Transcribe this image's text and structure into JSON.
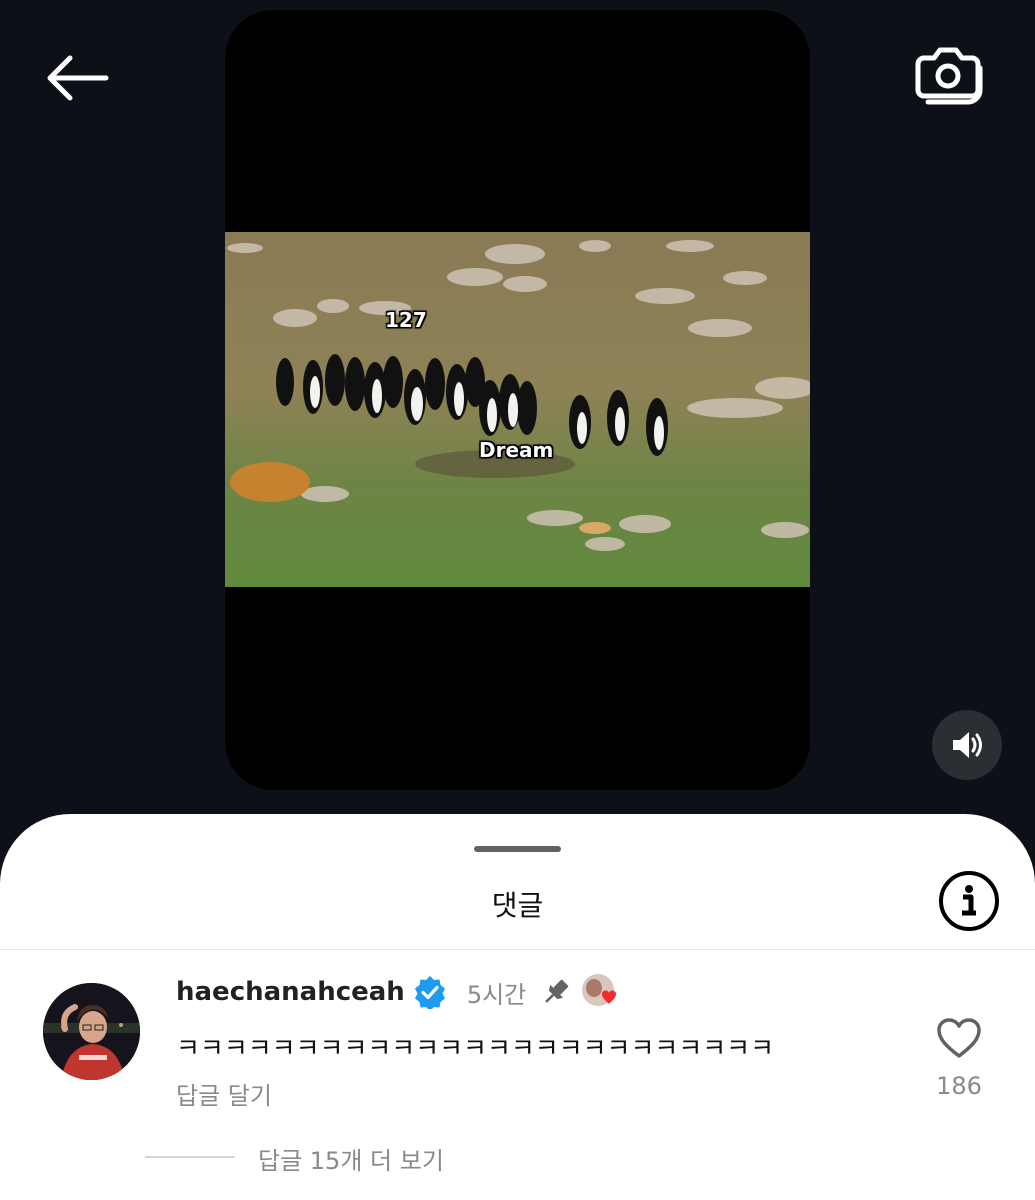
{
  "header": {
    "back_icon": "arrow-left-icon",
    "camera_icon": "camera-icon"
  },
  "video": {
    "overlay_top_label": "127",
    "overlay_bottom_label": "Dream",
    "volume_icon": "speaker-icon"
  },
  "comments_sheet": {
    "title": "댓글",
    "info_icon": "info-icon",
    "comment": {
      "username": "haechanahceah",
      "verified_icon": "verified-badge-icon",
      "time": "5시간",
      "pin_icon": "pin-icon",
      "text": "ㅋㅋㅋㅋㅋㅋㅋㅋㅋㅋㅋㅋㅋㅋㅋㅋㅋㅋㅋㅋㅋㅋㅋㅋㅋ",
      "reply_label": "답글 달기",
      "like_icon": "heart-outline-icon",
      "like_count": "186",
      "view_more_replies": "답글 15개 더 보기"
    }
  },
  "colors": {
    "background": "#0d1117",
    "verified_blue": "#1d9bf0",
    "muted_text": "#8a8a8a"
  }
}
